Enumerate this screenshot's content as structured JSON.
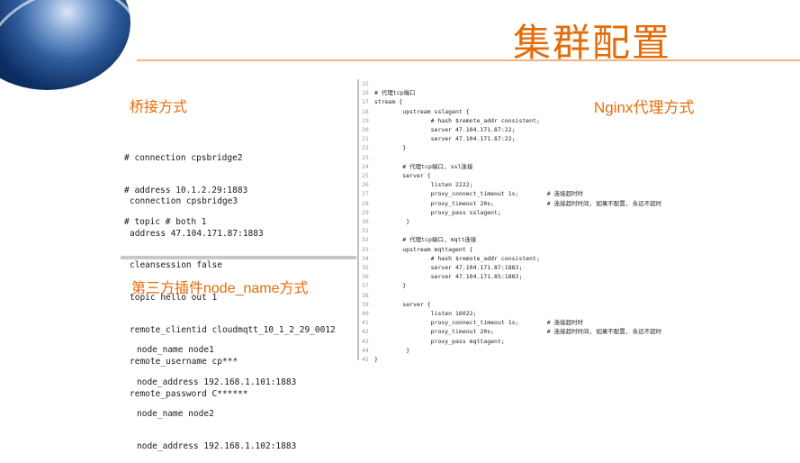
{
  "title": "集群配置",
  "labels": {
    "bridge": "桥接方式",
    "plugin": "第三方插件node_name方式",
    "nginx": "Nginx代理方式"
  },
  "bridge_comment": [
    "# connection cpsbridge2",
    "# address 10.1.2.29:1883",
    "# topic # both 1"
  ],
  "bridge_config": [
    "connection cpsbridge3",
    "address 47.104.171.87:1883",
    "cleansession false",
    "topic hello out 1",
    "remote_clientid cloudmqtt_10_1_2_29_0012",
    "remote_username cp***",
    "remote_password C******"
  ],
  "plugin_config": [
    "node_name node1",
    "node_address 192.168.1.101:1883",
    "node_name node2",
    "node_address 192.168.1.102:1883"
  ],
  "nginx_lines": [
    {
      "n": "15",
      "t": ""
    },
    {
      "n": "16",
      "t": "# 代理tcp端口"
    },
    {
      "n": "17",
      "t": "stream {"
    },
    {
      "n": "18",
      "t": "        upstream sslagent {"
    },
    {
      "n": "19",
      "t": "                # hash $remote_addr consistent;"
    },
    {
      "n": "20",
      "t": "                server 47.104.171.87:22;"
    },
    {
      "n": "21",
      "t": "                server 47.104.171.87:22;"
    },
    {
      "n": "22",
      "t": "        }"
    },
    {
      "n": "23",
      "t": ""
    },
    {
      "n": "24",
      "t": "        # 代理tcp端口, ssl连接"
    },
    {
      "n": "25",
      "t": "        server {"
    },
    {
      "n": "26",
      "t": "                listen 2222;"
    },
    {
      "n": "27",
      "t": "                proxy_connect_timeout 1s;        # 连接超时时"
    },
    {
      "n": "28",
      "t": "                proxy_timeout 20s;               # 连接超时时间, 如果不配置, 永远不超时"
    },
    {
      "n": "29",
      "t": "                proxy_pass sslagent;"
    },
    {
      "n": "30",
      "t": "         }"
    },
    {
      "n": "31",
      "t": ""
    },
    {
      "n": "32",
      "t": "        # 代理tcp端口, mqtt连接"
    },
    {
      "n": "33",
      "t": "        upstream mqttagent {"
    },
    {
      "n": "34",
      "t": "                # hash $remote_addr consistent;"
    },
    {
      "n": "35",
      "t": "                server 47.104.171.87:1883;"
    },
    {
      "n": "36",
      "t": "                server 47.104.171.85:1883;"
    },
    {
      "n": "37",
      "t": "        }"
    },
    {
      "n": "38",
      "t": ""
    },
    {
      "n": "39",
      "t": "        server {"
    },
    {
      "n": "40",
      "t": "                listen 16022;"
    },
    {
      "n": "41",
      "t": "                proxy_connect_timeout 1s;        # 连接超时时"
    },
    {
      "n": "42",
      "t": "                proxy_timeout 20s;               # 连接超时时间, 如果不配置, 永远不超时"
    },
    {
      "n": "43",
      "t": "                proxy_pass mqttagent;"
    },
    {
      "n": "44",
      "t": "         }"
    },
    {
      "n": "45",
      "t": "}"
    }
  ]
}
